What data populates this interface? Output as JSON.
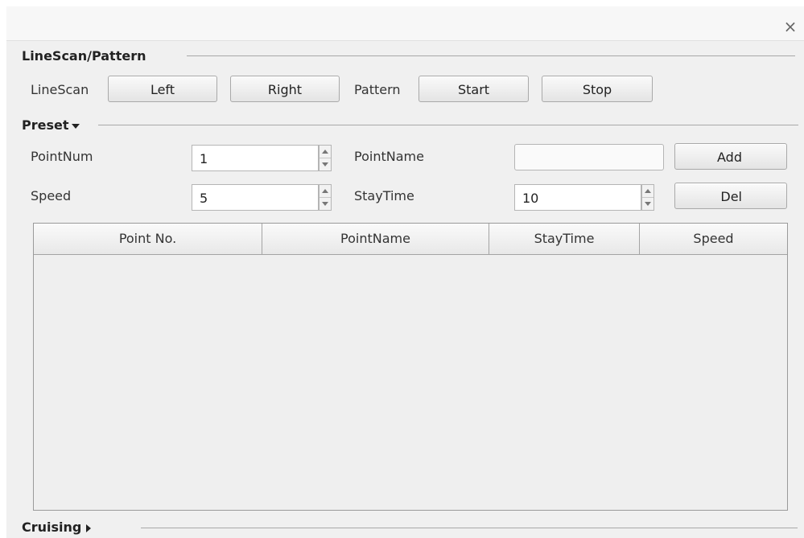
{
  "window": {
    "close_glyph": "×"
  },
  "linescan_pattern": {
    "title": "LineScan/Pattern",
    "linescan_label": "LineScan",
    "left_button": "Left",
    "right_button": "Right",
    "pattern_label": "Pattern",
    "start_button": "Start",
    "stop_button": "Stop"
  },
  "preset": {
    "title": "Preset",
    "expanded": true,
    "pointnum_label": "PointNum",
    "pointnum_value": "1",
    "pointname_label": "PointName",
    "pointname_value": "",
    "add_button": "Add",
    "speed_label": "Speed",
    "speed_value": "5",
    "staytime_label": "StayTime",
    "staytime_value": "10",
    "del_button": "Del"
  },
  "table": {
    "columns": [
      "Point No.",
      "PointName",
      "StayTime",
      "Speed"
    ],
    "rows": []
  },
  "cruising": {
    "title": "Cruising",
    "expanded": false
  },
  "icons": {
    "close": "close-icon",
    "spin_up": "spin-up-icon",
    "spin_down": "spin-down-icon",
    "expand": "chevron-down-icon",
    "collapse": "chevron-right-icon"
  }
}
